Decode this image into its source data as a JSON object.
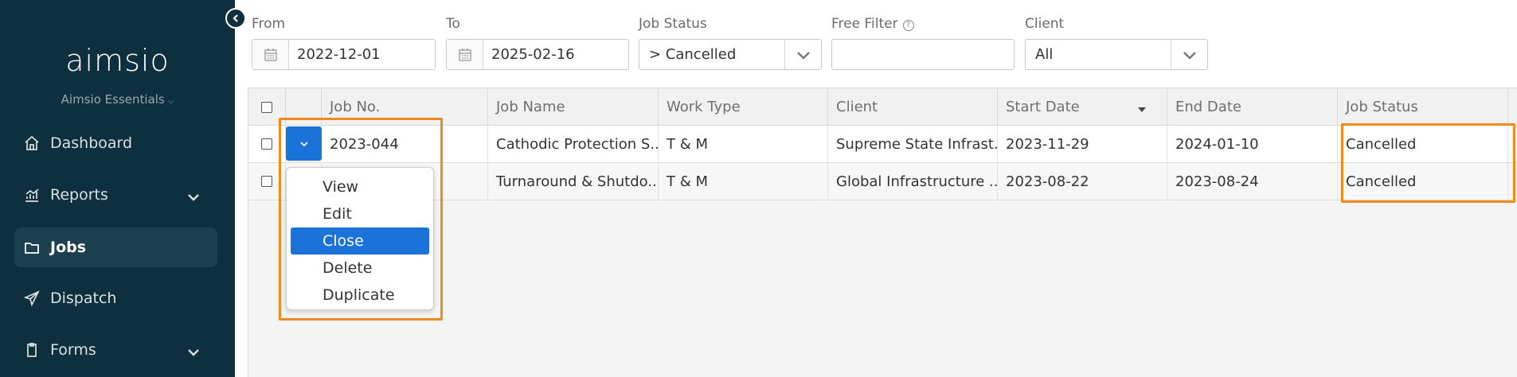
{
  "sidebar": {
    "logo": "aimsio",
    "workspace": "Aimsio Essentials",
    "items": [
      {
        "label": "Dashboard",
        "icon": "home-icon",
        "has_children": false,
        "active": false
      },
      {
        "label": "Reports",
        "icon": "chart-icon",
        "has_children": true,
        "active": false
      },
      {
        "label": "Jobs",
        "icon": "folder-icon",
        "has_children": false,
        "active": true
      },
      {
        "label": "Dispatch",
        "icon": "send-icon",
        "has_children": false,
        "active": false
      },
      {
        "label": "Forms",
        "icon": "clipboard-icon",
        "has_children": true,
        "active": false
      }
    ]
  },
  "filters": {
    "from": {
      "label": "From",
      "value": "2022-12-01",
      "icon": "calendar-icon"
    },
    "to": {
      "label": "To",
      "value": "2025-02-16",
      "icon": "calendar-icon"
    },
    "job_status": {
      "label": "Job Status",
      "value": "> Cancelled"
    },
    "free_filter": {
      "label": "Free Filter",
      "value": "",
      "icon": "help-icon"
    },
    "client": {
      "label": "Client",
      "value": "All"
    }
  },
  "table": {
    "columns": [
      "Job No.",
      "Job Name",
      "Work Type",
      "Client",
      "Start Date",
      "End Date",
      "Job Status"
    ],
    "sorted_column": "Start Date",
    "rows": [
      [
        "2023-044",
        "Cathodic Protection S...",
        "T & M",
        "Supreme State Infrast...",
        "2023-11-29",
        "2024-01-10",
        "Cancelled"
      ],
      [
        "",
        "Turnaround & Shutdo...",
        "T & M",
        "Global Infrastructure ...",
        "2023-08-22",
        "2023-08-24",
        "Cancelled"
      ]
    ]
  },
  "row_menu": {
    "items": [
      "View",
      "Edit",
      "Close",
      "Delete",
      "Duplicate"
    ],
    "selected": "Close"
  },
  "colors": {
    "sidebar_bg": "#0e2f3d",
    "accent": "#1a73d9",
    "highlight": "#f08a1c"
  }
}
